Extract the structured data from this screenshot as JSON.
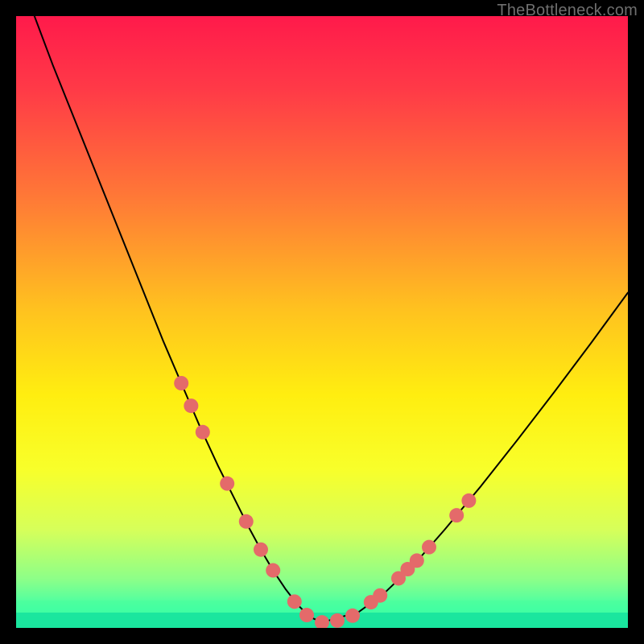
{
  "watermark": "TheBottleneck.com",
  "chart_data": {
    "type": "line",
    "title": "",
    "xlabel": "",
    "ylabel": "",
    "xlim": [
      0,
      100
    ],
    "ylim": [
      0,
      100
    ],
    "grid": false,
    "background_gradient": {
      "stops": [
        {
          "offset": 0.0,
          "color": "#ff1a4b"
        },
        {
          "offset": 0.12,
          "color": "#ff3a47"
        },
        {
          "offset": 0.3,
          "color": "#ff7a36"
        },
        {
          "offset": 0.48,
          "color": "#ffc21f"
        },
        {
          "offset": 0.62,
          "color": "#ffee10"
        },
        {
          "offset": 0.74,
          "color": "#f8ff2a"
        },
        {
          "offset": 0.84,
          "color": "#d6ff5a"
        },
        {
          "offset": 0.92,
          "color": "#8dff88"
        },
        {
          "offset": 0.97,
          "color": "#3effa8"
        },
        {
          "offset": 1.0,
          "color": "#18e7a6"
        }
      ]
    },
    "series": [
      {
        "name": "bottleneck-curve",
        "color": "#000000",
        "width": 2,
        "x": [
          3,
          6,
          9,
          12,
          15,
          18,
          21,
          24,
          27,
          30,
          33,
          36,
          38,
          40,
          42,
          44,
          46,
          48,
          50,
          56,
          60,
          65,
          70,
          76,
          82,
          88,
          94,
          100
        ],
        "y": [
          100,
          92,
          84.5,
          77,
          69.5,
          62,
          54.5,
          47,
          40,
          33,
          26.5,
          20.5,
          16.5,
          12.8,
          9.4,
          6.4,
          3.8,
          1.8,
          0.9,
          2.6,
          5.5,
          10.3,
          16,
          23.2,
          30.8,
          38.6,
          46.6,
          54.8
        ]
      }
    ],
    "markers": {
      "name": "highlight-dots",
      "color": "#e46a6a",
      "radius": 9,
      "points": [
        {
          "x": 27.0,
          "y": 40.0
        },
        {
          "x": 28.6,
          "y": 36.3
        },
        {
          "x": 30.5,
          "y": 32.0
        },
        {
          "x": 34.5,
          "y": 23.6
        },
        {
          "x": 37.6,
          "y": 17.4
        },
        {
          "x": 40.0,
          "y": 12.8
        },
        {
          "x": 42.0,
          "y": 9.4
        },
        {
          "x": 45.5,
          "y": 4.3
        },
        {
          "x": 47.5,
          "y": 2.1
        },
        {
          "x": 50.0,
          "y": 0.9
        },
        {
          "x": 52.5,
          "y": 1.2
        },
        {
          "x": 55.0,
          "y": 2.0
        },
        {
          "x": 58.0,
          "y": 4.2
        },
        {
          "x": 59.5,
          "y": 5.3
        },
        {
          "x": 62.5,
          "y": 8.1
        },
        {
          "x": 64.0,
          "y": 9.6
        },
        {
          "x": 65.5,
          "y": 11.0
        },
        {
          "x": 67.5,
          "y": 13.2
        },
        {
          "x": 72.0,
          "y": 18.4
        },
        {
          "x": 74.0,
          "y": 20.8
        }
      ]
    },
    "green_band": {
      "top_fraction": 0.955,
      "mid_fraction": 0.975
    }
  }
}
